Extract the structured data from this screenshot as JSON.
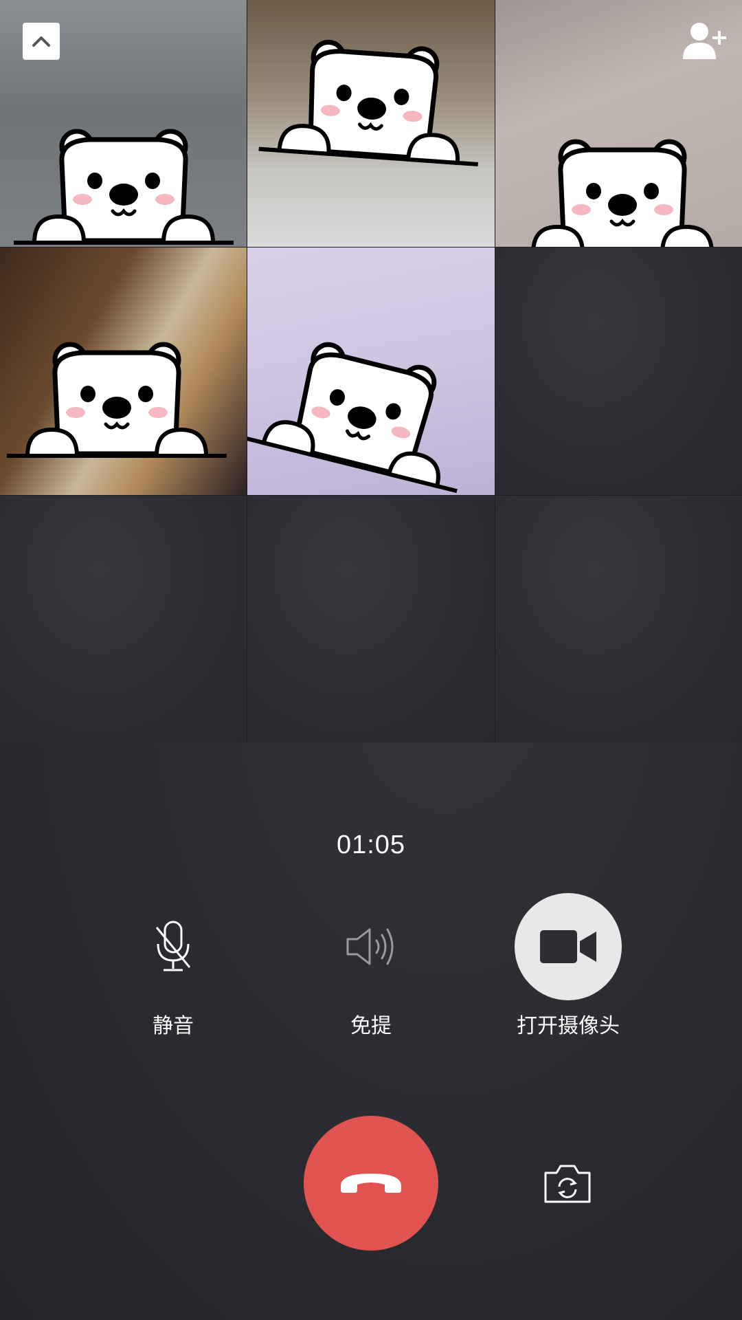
{
  "call": {
    "timer": "01:05",
    "participants": [
      {
        "tile": 0,
        "video": true
      },
      {
        "tile": 1,
        "video": true
      },
      {
        "tile": 2,
        "video": true
      },
      {
        "tile": 3,
        "video": true
      },
      {
        "tile": 4,
        "video": true
      },
      {
        "tile": 5,
        "video": false
      },
      {
        "tile": 6,
        "video": false
      },
      {
        "tile": 7,
        "video": false
      },
      {
        "tile": 8,
        "video": false
      }
    ]
  },
  "controls": {
    "mute_label": "静音",
    "speaker_label": "免提",
    "camera_label": "打开摄像头"
  },
  "icons": {
    "collapse": "chevron-up-icon",
    "add_participant": "add-user-icon",
    "mute": "mic-off-icon",
    "speaker": "speaker-icon",
    "camera": "video-camera-icon",
    "hangup": "hang-up-icon",
    "flip_camera": "switch-camera-icon"
  },
  "colors": {
    "hangup": "#e05350",
    "background": "#2a2b30",
    "camera_button": "#e8e8e8"
  }
}
